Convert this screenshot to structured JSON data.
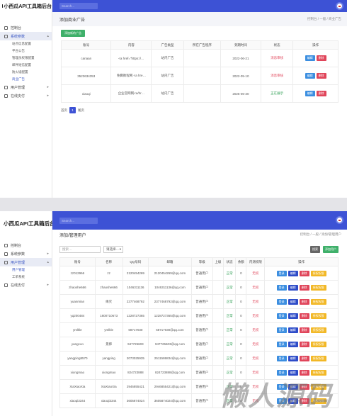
{
  "app": {
    "title": "小西瓜API工具箱后台",
    "search_placeholder": "Search..."
  },
  "screen1": {
    "nav": [
      {
        "label": "控制台",
        "icon": "monitor-icon"
      },
      {
        "label": "系统参数",
        "icon": "gear-icon",
        "active": true,
        "children": [
          "站点信息配置",
          "平台公告",
          "管理员权限配置",
          "邮件短信配置",
          "防火墙配置",
          "商业广告"
        ]
      },
      {
        "label": "用户管理",
        "icon": "users-icon"
      },
      {
        "label": "在线支付",
        "icon": "card-icon"
      }
    ],
    "page_title": "添加商业广告",
    "breadcrumb": "控制台 / 一般 / 商业广告",
    "add_button": "添加新的广告",
    "columns": [
      "账号",
      "内容",
      "广告类型",
      "所在广告程序",
      "到期时间",
      "状态",
      "操作"
    ],
    "rows": [
      {
        "account": "canaan",
        "content": "<a href=\"https://…",
        "type": "站内广告",
        "program": "",
        "expire": "2022-06-21",
        "status": "消息审核"
      },
      {
        "account": "3523634353",
        "content": "免費教程网 <a hre…",
        "type": "站内广告",
        "program": "",
        "expire": "2022-05-10",
        "status": "消息审核"
      },
      {
        "account": "xiaoqi",
        "content": "企业官网网<a/hr…",
        "type": "站内广告",
        "program": "",
        "expire": "2025-06-30",
        "status": "正在展示"
      }
    ],
    "edit_label": "编辑",
    "delete_label": "删除",
    "pager": {
      "first": "首页",
      "current": "1",
      "last": "尾页"
    }
  },
  "screen2": {
    "nav": [
      {
        "label": "控制台",
        "icon": "monitor-icon"
      },
      {
        "label": "系统参数",
        "icon": "gear-icon"
      },
      {
        "label": "用户管理",
        "icon": "users-icon",
        "active": true,
        "children": [
          "用户管理",
          "工单系统"
        ]
      },
      {
        "label": "在线支付",
        "icon": "card-icon"
      }
    ],
    "page_title": "添加/管理用户",
    "breadcrumb": "控制台 / 一般 / 添加/管理用户",
    "search_placeholder": "搜索…",
    "select_value": "请选择…",
    "search_button": "搜索",
    "add_button": "添加用户",
    "columns": [
      "账号",
      "名称",
      "QQ号码",
      "邮箱",
      "等级",
      "上级",
      "状态",
      "余额",
      "内测权限",
      "操作"
    ],
    "rows": [
      {
        "account": "zz012966",
        "name": "zz",
        "qq": "2120454269",
        "email": "2120454269@qq.com",
        "level": "普通用户",
        "status": "正常",
        "balance": "0",
        "beta": "无权"
      },
      {
        "account": "zhaoshe666",
        "name": "zhaoshe666",
        "qq": "1046311136",
        "email": "1046311136@qq.com",
        "level": "普通用户",
        "status": "正常",
        "balance": "0",
        "beta": "无权"
      },
      {
        "account": "yuanmian",
        "name": "缘灭",
        "qq": "2377468792",
        "email": "2377468792@qq.com",
        "level": "普通用户",
        "status": "正常",
        "balance": "0",
        "beta": "无权"
      },
      {
        "account": "yq200484",
        "name": "1800710673",
        "qq": "1228727365",
        "email": "1228727365@qq.com",
        "level": "普通用户",
        "status": "正常",
        "balance": "0",
        "beta": "无权"
      },
      {
        "account": "ymlkle",
        "name": "ymlkle",
        "qq": "68717030",
        "email": "68717030@qq.com",
        "level": "普通用户",
        "status": "正常",
        "balance": "0",
        "beta": "无权"
      },
      {
        "account": "yangcoo",
        "name": "景拜",
        "qq": "947725603",
        "email": "947725603@qq.com",
        "level": "普通用户",
        "status": "正常",
        "balance": "0",
        "beta": "无权"
      },
      {
        "account": "yangping8570",
        "name": "yangping",
        "qq": "2073025935",
        "email": "2511586834@qq.com",
        "level": "普通用户",
        "status": "正常",
        "balance": "0",
        "beta": "无权"
      },
      {
        "account": "xiongmao",
        "name": "xiongmao",
        "qq": "824723888",
        "email": "824723888@qq.com",
        "level": "普通用户",
        "status": "正常",
        "balance": "0",
        "beta": "无权"
      },
      {
        "account": "XiaXiaoXia",
        "name": "XiaXiaoXia",
        "qq": "2946855421",
        "email": "2946855421@qq.com",
        "level": "普通用户",
        "status": "正常",
        "balance": "0",
        "beta": "无权"
      },
      {
        "account": "xiaoqi3344",
        "name": "xiaoqi3344",
        "qq": "3605874024",
        "email": "3605874024@qq.com",
        "level": "普通用户",
        "status": "正常",
        "balance": "0",
        "beta": "无权"
      }
    ],
    "ops": [
      "登录",
      "编辑",
      "删除",
      "授权权限"
    ],
    "watermark": "懒人源码"
  }
}
